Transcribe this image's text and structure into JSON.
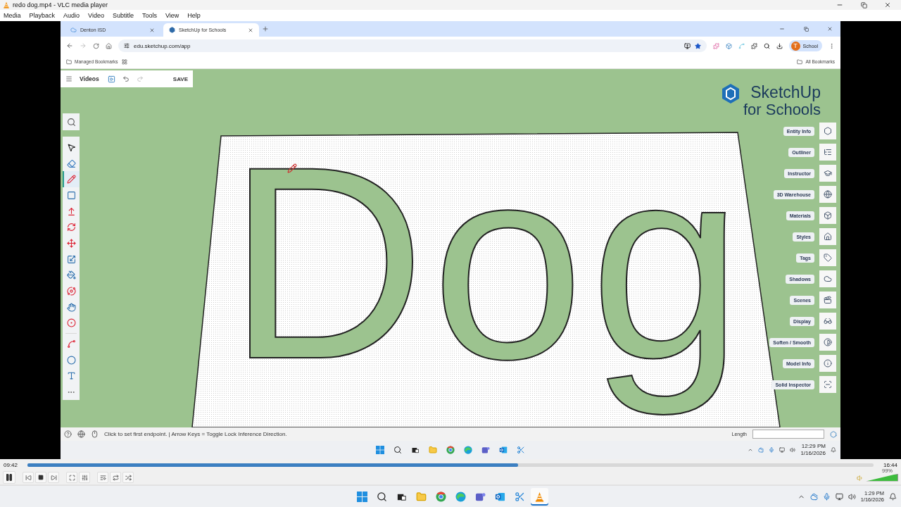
{
  "vlc": {
    "title": "redo dog.mp4 - VLC media player",
    "menu": [
      "Media",
      "Playback",
      "Audio",
      "Video",
      "Subtitle",
      "Tools",
      "View",
      "Help"
    ],
    "elapsed": "09:42",
    "total": "16:44",
    "progress": {
      "level": 0.58
    },
    "volume": {
      "level": 0.99,
      "label": "99%"
    }
  },
  "browser": {
    "tabs": [
      {
        "label": "Denton ISD",
        "selected": false
      },
      {
        "label": "SketchUp for Schools",
        "selected": true
      }
    ],
    "url": "edu.sketchup.com/app",
    "profile_initial": "T",
    "profile": "School",
    "bookmarks": {
      "managed": "Managed Bookmarks",
      "all": "All Bookmarks"
    }
  },
  "sketchup": {
    "toolbar": {
      "title": "Videos",
      "save": "SAVE",
      "redo": {
        "disabled": true
      }
    },
    "logo": {
      "name": "SketchUp",
      "tagline": "for Schools"
    },
    "tools": [
      {
        "kind": "select",
        "selected": false
      },
      {
        "kind": "eraser",
        "selected": false
      },
      {
        "kind": "pencil",
        "selected": true
      },
      {
        "kind": "rectangle",
        "selected": false
      },
      {
        "kind": "pushpull",
        "selected": false
      },
      {
        "kind": "rotate",
        "selected": false
      },
      {
        "kind": "move",
        "selected": false
      },
      {
        "kind": "scale",
        "selected": false
      },
      {
        "kind": "paint",
        "selected": false
      },
      {
        "kind": "orbit",
        "selected": false
      },
      {
        "kind": "pan",
        "selected": false
      },
      {
        "kind": "target",
        "selected": false
      },
      {
        "kind": "arc",
        "selected": false
      },
      {
        "kind": "circle",
        "selected": false
      },
      {
        "kind": "text",
        "selected": false
      }
    ],
    "panels": [
      {
        "label": "Entity Info",
        "kind": "entity"
      },
      {
        "label": "Outliner",
        "kind": "outliner"
      },
      {
        "label": "Instructor",
        "kind": "instructor"
      },
      {
        "label": "3D Warehouse",
        "kind": "warehouse"
      },
      {
        "label": "Materials",
        "kind": "materials"
      },
      {
        "label": "Styles",
        "kind": "styles"
      },
      {
        "label": "Tags",
        "kind": "tags"
      },
      {
        "label": "Shadows",
        "kind": "shadows"
      },
      {
        "label": "Scenes",
        "kind": "scenes"
      },
      {
        "label": "Display",
        "kind": "display"
      },
      {
        "label": "Soften / Smooth",
        "kind": "soften"
      },
      {
        "label": "Model Info",
        "kind": "info"
      },
      {
        "label": "Solid Inspector",
        "kind": "solid"
      }
    ],
    "model_text": "Dog",
    "status": "Click to set first endpoint. | Arrow Keys = Toggle Lock Inference Direction.",
    "length_label": "Length"
  },
  "inner_taskbar": {
    "apps": [
      {
        "kind": "start"
      },
      {
        "kind": "search"
      },
      {
        "kind": "taskview"
      },
      {
        "kind": "explorer"
      },
      {
        "kind": "chrome"
      },
      {
        "kind": "edge"
      },
      {
        "kind": "teams"
      },
      {
        "kind": "outlook"
      },
      {
        "kind": "snip"
      }
    ],
    "time": "12:29 PM",
    "date": "1/16/2026"
  },
  "taskbar": {
    "apps": [
      {
        "kind": "start",
        "selected": false
      },
      {
        "kind": "search",
        "selected": false
      },
      {
        "kind": "taskview",
        "selected": false
      },
      {
        "kind": "explorer",
        "selected": false
      },
      {
        "kind": "chrome",
        "selected": false
      },
      {
        "kind": "edge",
        "selected": false
      },
      {
        "kind": "teams",
        "selected": false
      },
      {
        "kind": "outlook",
        "selected": false
      },
      {
        "kind": "snip",
        "selected": false
      },
      {
        "kind": "vlc",
        "selected": true
      }
    ],
    "time": "1:29 PM",
    "date": "1/16/2026"
  }
}
